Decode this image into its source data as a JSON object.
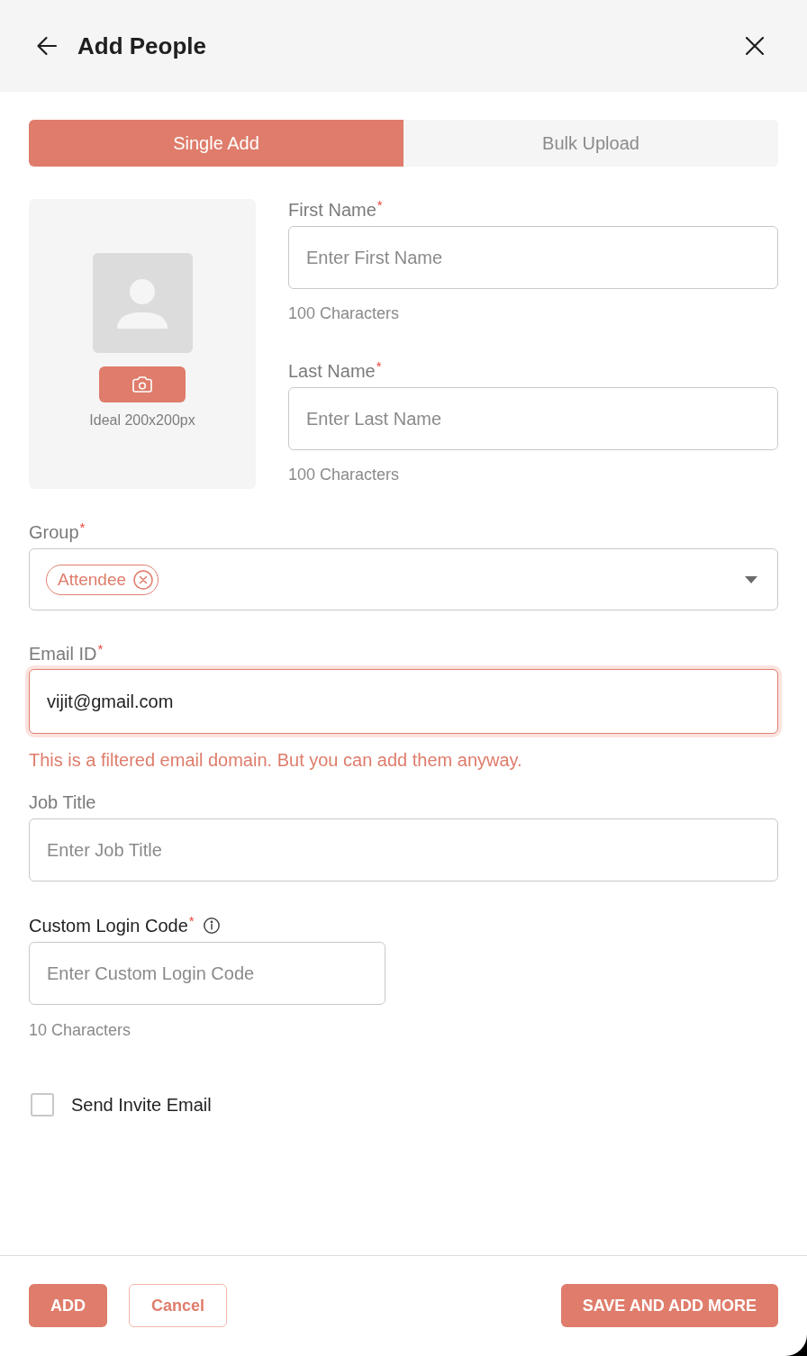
{
  "header": {
    "title": "Add People"
  },
  "tabs": [
    {
      "label": "Single Add",
      "selected": true
    },
    {
      "label": "Bulk Upload",
      "selected": false
    }
  ],
  "photo": {
    "hint": "Ideal 200x200px"
  },
  "name_fields": [
    {
      "label": "First Name$^{*}$",
      "placeholder": "Enter First Name",
      "helper": "100 Characters",
      "focused": false
    },
    {
      "label": "Last Name$^{*}$",
      "placeholder": "Enter Last Name",
      "helper": "100 Characters",
      "focused": false
    }
  ],
  "fields": [
    {
      "kind": "select",
      "label": "Group$^{*}$",
      "chips": [
        {
          "label": "Attendee"
        }
      ]
    },
    {
      "kind": "text",
      "label": "Email ID$^{*}$",
      "value": "vijit@gmail.com",
      "focused": true,
      "error": "This is a filtered email domain. But you can add them anyway."
    },
    {
      "kind": "text",
      "label": "Job Title",
      "placeholder": "Enter Job Title",
      "focused": false
    },
    {
      "kind": "short",
      "label": "Custom Login Code$^{*}$",
      "info": true,
      "placeholder": "Enter Custom Login Code",
      "helper": "10 Characters",
      "focused": false
    },
    {
      "kind": "checkbox",
      "label": "Send Invite Email",
      "checked": false
    }
  ],
  "footer": {
    "left": [
      {
        "label": "ADD",
        "kind": "primary"
      },
      {
        "label": "Cancel",
        "kind": "outline"
      }
    ],
    "right": [
      {
        "label": "SAVE AND ADD MORE",
        "kind": "primary"
      }
    ]
  }
}
